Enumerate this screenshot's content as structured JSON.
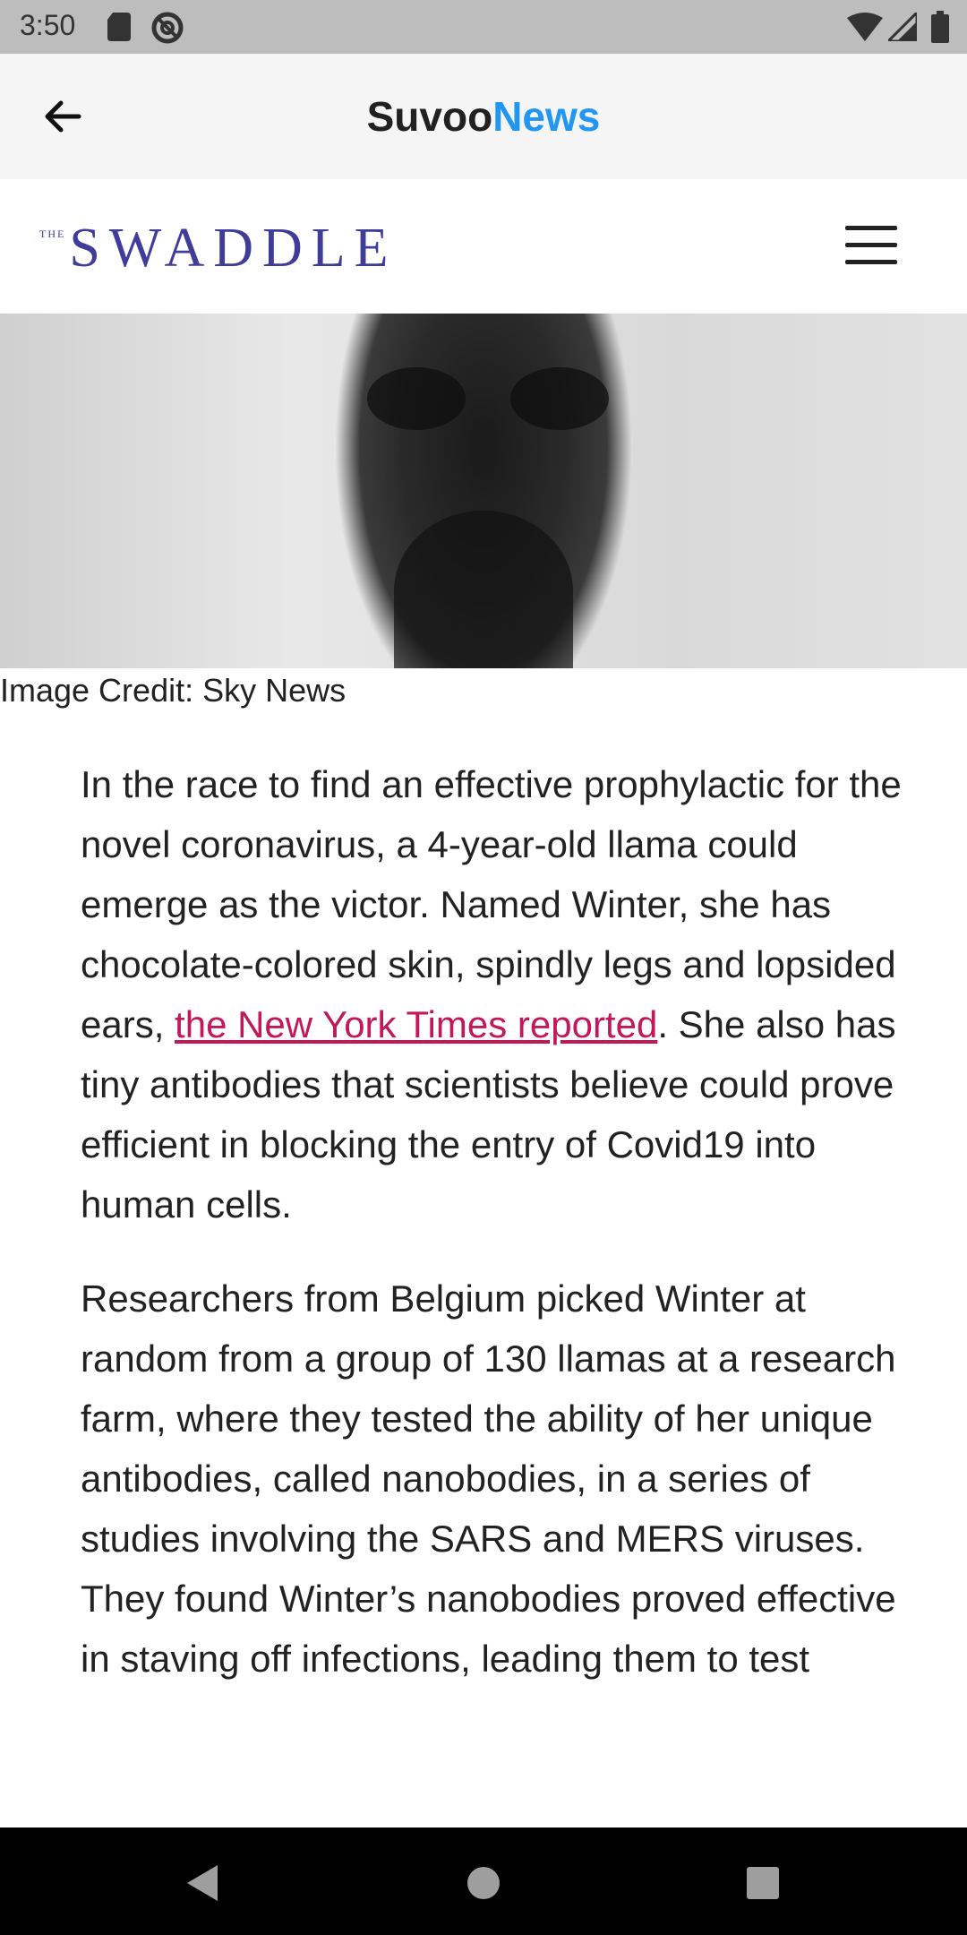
{
  "status_bar": {
    "time": "3:50"
  },
  "app_bar": {
    "title_part1": "Suvoo",
    "title_part2": "News",
    "accent_color": "#2196f3"
  },
  "site": {
    "logo_small": "THE",
    "logo_main": "SWADDLE",
    "logo_color": "#3f3d99"
  },
  "article": {
    "image_caption": "Image Credit: Sky News",
    "p1_before_link": "In the race to find an effective prophylactic for the novel coronavirus, a 4-year-old llama could emerge as the victor. Named Winter, she has chocolate-colored skin, spindly legs and lopsided ears, ",
    "p1_link": "the New York Times reported",
    "p1_after_link": ". She also has tiny antibodies that scientists believe could prove efficient in blocking the entry of Covid19 into human cells.",
    "p2": "Researchers from Belgium picked Winter at random from a group of 130 llamas at a research farm, where they tested the ability of her unique antibodies, called nanobodies, in a series of studies involving the SARS and MERS viruses. They found Winter’s nanobodies proved effective in staving off infections, leading them to test",
    "link_color": "#c2185b"
  }
}
